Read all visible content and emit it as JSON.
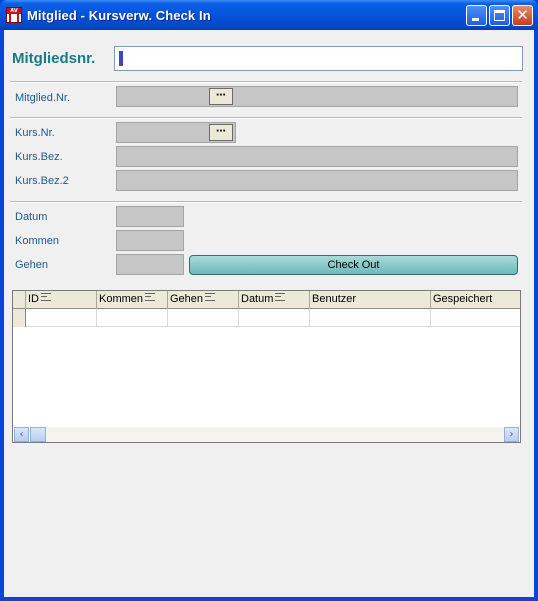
{
  "window": {
    "title": "Mitglied - Kursverw. Check In",
    "icon": "app-logo-icon"
  },
  "member_search": {
    "label": "Mitgliedsnr.",
    "value": ""
  },
  "member_section": {
    "member_no_label": "Mitglied.Nr.",
    "member_no_value": ""
  },
  "course_section": {
    "course_no_label": "Kurs.Nr.",
    "course_desc_label": "Kurs.Bez.",
    "course_desc2_label": "Kurs.Bez.2"
  },
  "time_section": {
    "date_label": "Datum",
    "arrive_label": "Kommen",
    "leave_label": "Gehen",
    "checkout_label": "Check Out"
  },
  "grid": {
    "columns": [
      "ID",
      "Kommen",
      "Gehen",
      "Datum",
      "Benutzer",
      "Gespeichert"
    ],
    "rows": []
  },
  "colors": {
    "label_teal": "#167d86",
    "label_blue": "#1e5a8c",
    "checkout_button": "#8ccaca",
    "title_bar": "#0553dc"
  },
  "icons": {
    "picker": "ellipsis-picker-icon",
    "scroll_left": "chevron-left-icon",
    "scroll_right": "chevron-right-icon",
    "sort": "sort-icon"
  }
}
